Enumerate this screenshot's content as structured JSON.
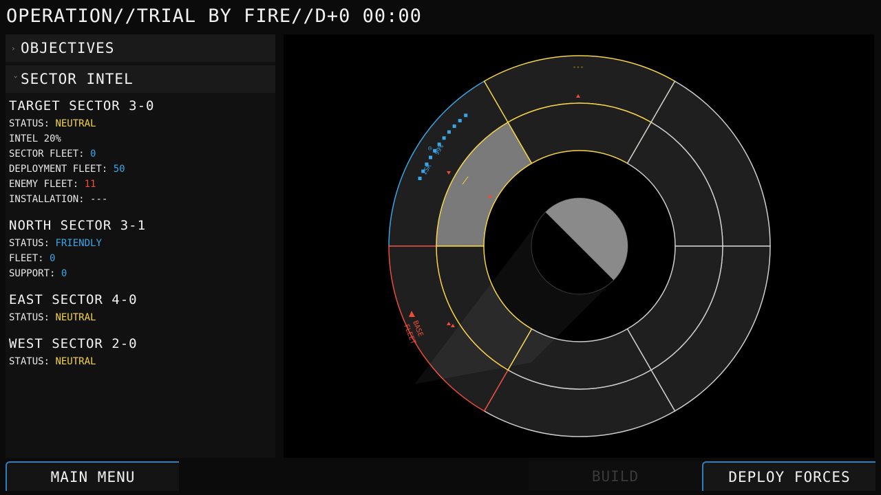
{
  "header": {
    "title": "OPERATION//TRIAL BY FIRE//D+0 00:00"
  },
  "accordion": {
    "objectives_label": "OBJECTIVES",
    "sector_intel_label": "SECTOR INTEL",
    "chevron_collapsed": "›",
    "chevron_expanded": "›"
  },
  "intel": {
    "target": {
      "title": "TARGET SECTOR 3-0",
      "status_label": "STATUS:",
      "status_value": "NEUTRAL",
      "intel_text": "INTEL 20%",
      "sector_fleet_label": "SECTOR FLEET:",
      "sector_fleet_value": "0",
      "deployment_fleet_label": "DEPLOYMENT FLEET:",
      "deployment_fleet_value": "50",
      "enemy_fleet_label": "ENEMY FLEET:",
      "enemy_fleet_value": "11",
      "installation_label": "INSTALLATION:",
      "installation_value": "---"
    },
    "north": {
      "title": "NORTH SECTOR 3-1",
      "status_label": "STATUS:",
      "status_value": "FRIENDLY",
      "fleet_label": "FLEET:",
      "fleet_value": "0",
      "support_label": "SUPPORT:",
      "support_value": "0"
    },
    "east": {
      "title": "EAST SECTOR 4-0",
      "status_label": "STATUS:",
      "status_value": "NEUTRAL"
    },
    "west": {
      "title": "WEST SECTOR 2-0",
      "status_label": "STATUS:",
      "status_value": "NEUTRAL"
    }
  },
  "map": {
    "top_marker": "---",
    "isr_label": "ISR",
    "isr_percent": "99%",
    "isr_level": 0.99,
    "base_label": "BASE",
    "fleet_label": "FLEET",
    "colors": {
      "friendly": "#3aa6e8",
      "neutral": "#f5d447",
      "enemy": "#ef4b3a",
      "sector_fill": "#1f1f1f",
      "selected_fill": "#7a7a7a",
      "border": "#cfcfcf"
    }
  },
  "buttons": {
    "main_menu": "MAIN MENU",
    "build": "BUILD",
    "deploy": "DEPLOY FORCES"
  }
}
